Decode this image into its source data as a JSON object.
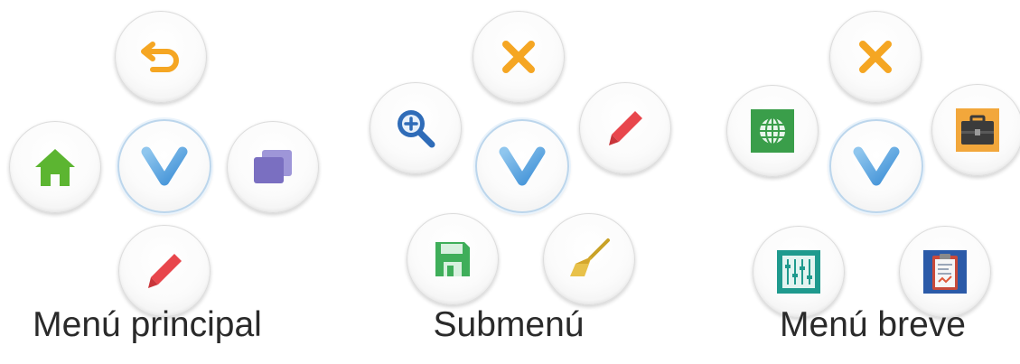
{
  "menus": [
    {
      "caption": "Menú principal",
      "buttons": [
        "back-icon",
        "home-icon",
        "app-logo-v-icon",
        "windows-icon",
        "pencil-icon"
      ]
    },
    {
      "caption": "Submenú",
      "buttons": [
        "close-icon",
        "zoom-in-icon",
        "app-logo-v-icon",
        "pencil-icon",
        "save-icon",
        "broom-icon"
      ]
    },
    {
      "caption": "Menú breve",
      "buttons": [
        "close-icon",
        "globe-icon",
        "app-logo-v-icon",
        "briefcase-icon",
        "equalizer-icon",
        "clipboard-icon"
      ]
    }
  ],
  "colors": {
    "orange": "#f5a623",
    "green": "#5cb531",
    "purple": "#7a6fc1",
    "red": "#e8464c",
    "blue": "#2f6cb8",
    "teal": "#1f9a8e",
    "v_logo": "#5aa7e0"
  }
}
